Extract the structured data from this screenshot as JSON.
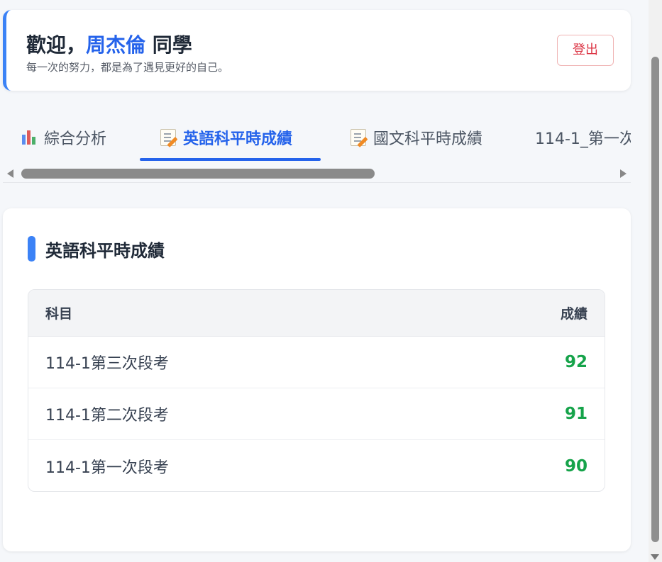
{
  "header": {
    "welcome_prefix": "歡迎，",
    "student_name": "周杰倫",
    "welcome_suffix": " 同學",
    "motto": "每一次的努力，都是為了遇見更好的自己。",
    "logout_label": "登出"
  },
  "tabs": [
    {
      "label": "綜合分析",
      "icon": "bar-chart-icon",
      "active": false
    },
    {
      "label": "英語科平時成績",
      "icon": "memo-icon",
      "active": true
    },
    {
      "label": "國文科平時成績",
      "icon": "memo-icon",
      "active": false
    },
    {
      "label": "114-1_第一次",
      "icon": "",
      "active": false
    }
  ],
  "section": {
    "title": "英語科平時成績"
  },
  "table": {
    "headers": {
      "subject": "科目",
      "score": "成績"
    },
    "rows": [
      {
        "subject": "114-1第三次段考",
        "score": "92"
      },
      {
        "subject": "114-1第二次段考",
        "score": "91"
      },
      {
        "subject": "114-1第一次段考",
        "score": "90"
      }
    ]
  },
  "colors": {
    "accent": "#2563eb",
    "score_green": "#16a34a",
    "logout_red": "#dc3545"
  }
}
